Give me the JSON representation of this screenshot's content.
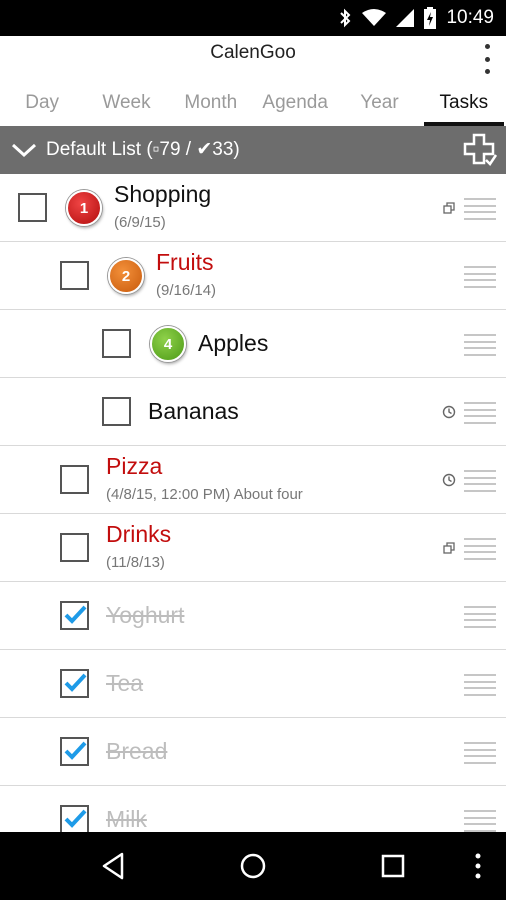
{
  "status_bar": {
    "time": "10:49",
    "icons": [
      "bluetooth-icon",
      "wifi-icon",
      "signal-icon",
      "battery-charging-icon"
    ]
  },
  "app": {
    "title": "CalenGoo"
  },
  "tabs": [
    {
      "label": "Day",
      "active": false
    },
    {
      "label": "Week",
      "active": false
    },
    {
      "label": "Month",
      "active": false
    },
    {
      "label": "Agenda",
      "active": false
    },
    {
      "label": "Year",
      "active": false
    },
    {
      "label": "Tasks",
      "active": true
    }
  ],
  "list_header": {
    "label": "Default List (▫79 / ✔33)",
    "add_icon": "add-task-icon"
  },
  "tasks": [
    {
      "name": "Shopping",
      "sub": "(6/9/15)",
      "level": 0,
      "priority": "1",
      "badge_color": "#d11f1f",
      "checked": false,
      "name_color": "#111111",
      "indicator": "subtasks-icon"
    },
    {
      "name": "Fruits",
      "sub": "(9/16/14)",
      "level": 1,
      "priority": "2",
      "badge_color": "#e07020",
      "checked": false,
      "name_color": "#c20d0d",
      "indicator": ""
    },
    {
      "name": "Apples",
      "sub": "",
      "level": 2,
      "priority": "4",
      "badge_color": "#6ab82c",
      "checked": false,
      "name_color": "#111111",
      "indicator": ""
    },
    {
      "name": "Bananas",
      "sub": "",
      "level": 2,
      "priority": "",
      "checked": false,
      "name_color": "#111111",
      "indicator": "clock-icon"
    },
    {
      "name": "Pizza",
      "sub": "(4/8/15, 12:00 PM) About four",
      "level": 1,
      "priority": "",
      "checked": false,
      "name_color": "#c20d0d",
      "indicator": "clock-icon"
    },
    {
      "name": "Drinks",
      "sub": "(11/8/13)",
      "level": 1,
      "priority": "",
      "checked": false,
      "name_color": "#c20d0d",
      "indicator": "subtasks-icon"
    },
    {
      "name": "Yoghurt",
      "sub": "",
      "level": 1,
      "priority": "",
      "checked": true,
      "name_color": "#bdbdbd",
      "indicator": ""
    },
    {
      "name": "Tea",
      "sub": "",
      "level": 1,
      "priority": "",
      "checked": true,
      "name_color": "#bdbdbd",
      "indicator": ""
    },
    {
      "name": "Bread",
      "sub": "",
      "level": 1,
      "priority": "",
      "checked": true,
      "name_color": "#bdbdbd",
      "indicator": ""
    },
    {
      "name": "Milk",
      "sub": "",
      "level": 1,
      "priority": "",
      "checked": true,
      "name_color": "#bdbdbd",
      "indicator": ""
    }
  ],
  "colors": {
    "checkmark": "#1e9be8",
    "header_bg": "#6d6d6d",
    "overdue_text": "#c20d0d"
  },
  "nav_bar": {
    "icons": [
      "back-icon",
      "home-icon",
      "recents-icon",
      "menu-icon"
    ]
  }
}
